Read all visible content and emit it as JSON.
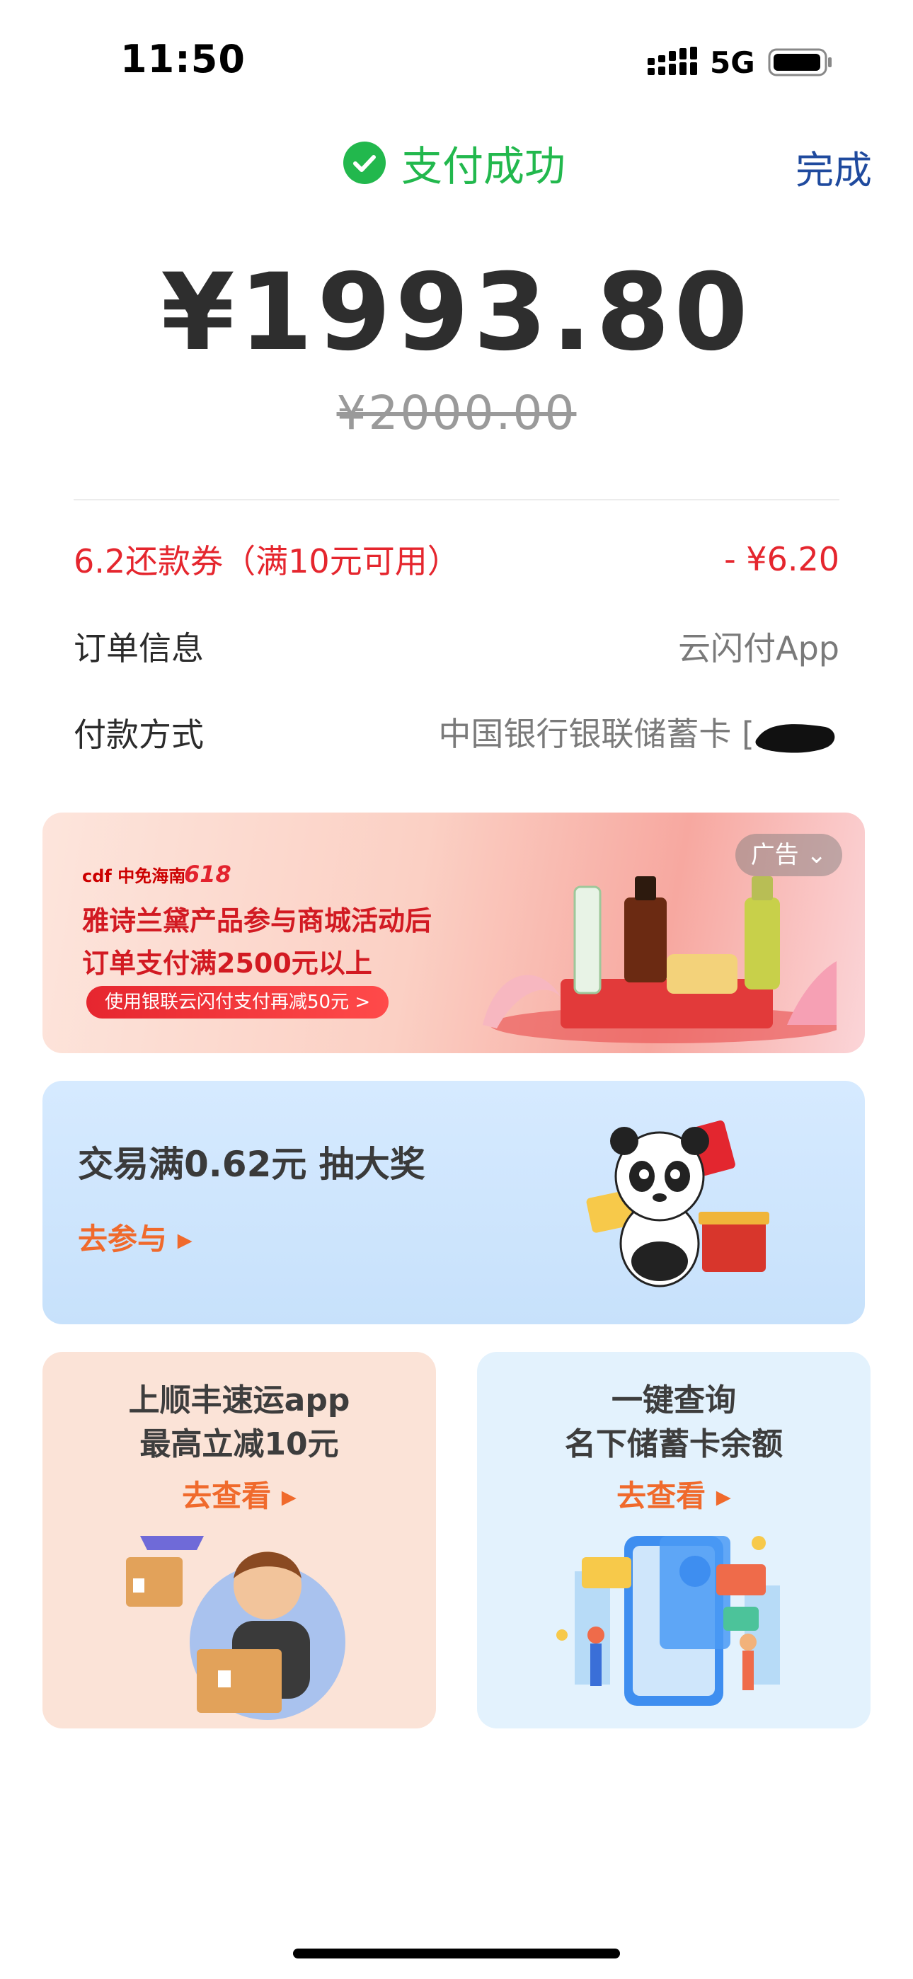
{
  "status_bar": {
    "time": "11:50",
    "network": "5G"
  },
  "header": {
    "success_text": "支付成功",
    "done_label": "完成"
  },
  "payment": {
    "amount": "¥1993.80",
    "original_amount": "¥2000.00"
  },
  "details": {
    "coupon_label": "6.2还款券（满10元可用）",
    "coupon_value": "- ¥6.20",
    "order_label": "订单信息",
    "order_value": "云闪付App",
    "method_label": "付款方式",
    "method_value": "中国银行银联储蓄卡 ["
  },
  "ad_banner": {
    "logo_text": "cdf 中免海南",
    "event_text": "618",
    "line1": "雅诗兰黛产品参与商城活动后",
    "line2": "订单支付满2500元以上",
    "pill_text": "使用银联云闪付支付再减50元 >",
    "tag_label": "广告"
  },
  "lottery": {
    "title": "交易满0.62元 抽大奖",
    "link": "去参与 ▸"
  },
  "promo_left": {
    "line1": "上顺丰速运app",
    "line2": "最高立减10元",
    "link": "去查看 ▸"
  },
  "promo_right": {
    "line1": "一键查询",
    "line2": "名下储蓄卡余额",
    "link": "去查看 ▸"
  },
  "colors": {
    "success": "#22b84d",
    "link_blue": "#1f4a9e",
    "discount_red": "#e5262e",
    "cta_orange": "#f06a2c"
  }
}
